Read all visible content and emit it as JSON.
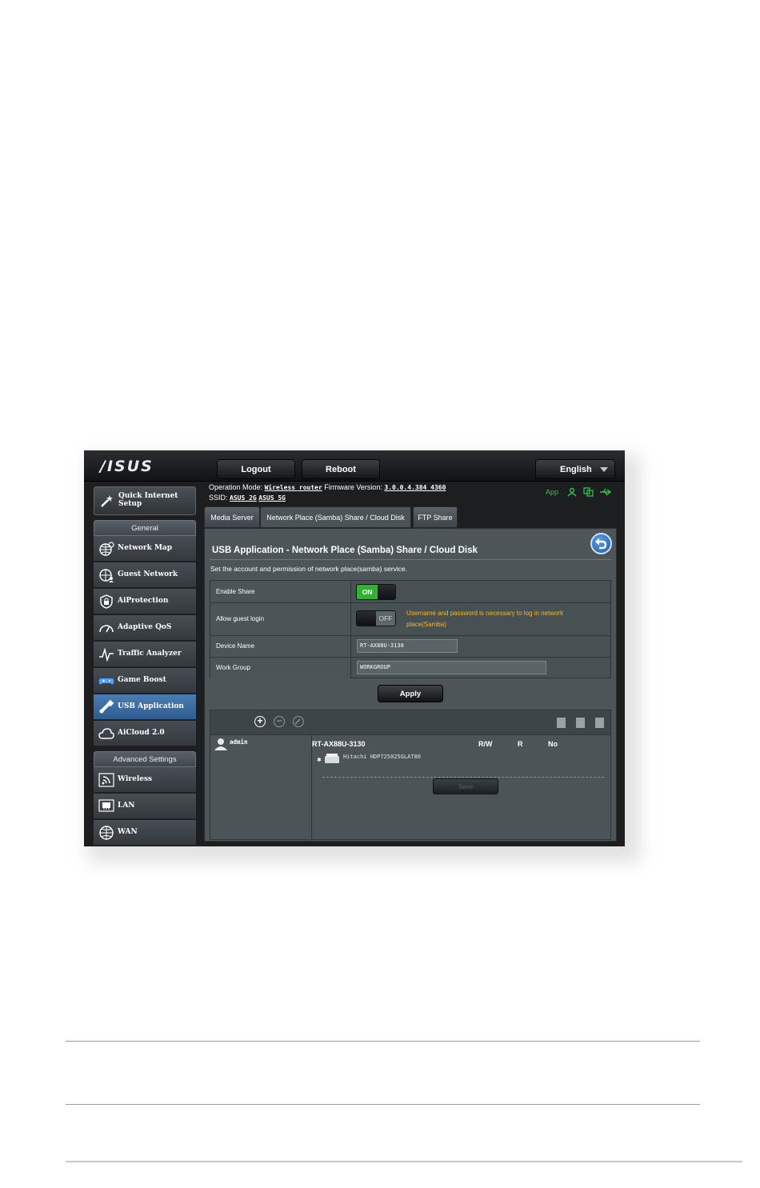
{
  "header": {
    "logo": "/ISUS",
    "logout_label": "Logout",
    "reboot_label": "Reboot",
    "language": "English"
  },
  "status": {
    "operation_mode_label": "Operation Mode:",
    "operation_mode_value": "Wireless router",
    "firmware_label": "Firmware Version:",
    "firmware_value": "3.0.0.4.384_4360",
    "ssid_label": "SSID:",
    "ssid_2g": "ASUS_2G",
    "ssid_5g": "ASUS_5G",
    "app_label": "App"
  },
  "sidebar": {
    "quick_setup": "Quick Internet Setup",
    "general_header": "General",
    "general_items": [
      {
        "label": "Network Map",
        "icon": "globe-icon"
      },
      {
        "label": "Guest Network",
        "icon": "guest-globe-icon"
      },
      {
        "label": "AiProtection",
        "icon": "shield-lock-icon"
      },
      {
        "label": "Adaptive QoS",
        "icon": "gauge-icon"
      },
      {
        "label": "Traffic Analyzer",
        "icon": "traffic-icon"
      },
      {
        "label": "Game Boost",
        "icon": "gamepad-icon"
      },
      {
        "label": "USB Application",
        "icon": "usb-icon"
      },
      {
        "label": "AiCloud 2.0",
        "icon": "cloud-icon"
      }
    ],
    "advanced_header": "Advanced Settings",
    "advanced_items": [
      {
        "label": "Wireless",
        "icon": "wifi-icon"
      },
      {
        "label": "LAN",
        "icon": "lan-icon"
      },
      {
        "label": "WAN",
        "icon": "wan-globe-icon"
      }
    ]
  },
  "tabs": [
    "Media Server",
    "Network Place (Samba) Share / Cloud Disk",
    "FTP Share"
  ],
  "main": {
    "title": "USB Application - Network Place (Samba) Share / Cloud Disk",
    "description": "Set the account and permission of network place(samba) service.",
    "enable_share_label": "Enable Share",
    "enable_share_state": "ON",
    "guest_login_label": "Allow guest login",
    "guest_login_state": "OFF",
    "guest_warning": "Username and password is necessary to log in network place(Samba)",
    "device_name_label": "Device Name",
    "device_name_value": "RT-AX88U-3130",
    "work_group_label": "Work Group",
    "work_group_value": "WORKGROUP",
    "apply_label": "Apply",
    "user": "admin",
    "device_header": "RT-AX88U-3130",
    "col_rw": "R/W",
    "col_r": "R",
    "col_no": "No",
    "disk_name": "Hitachi HDP725025GLAT80",
    "save_label": "Save"
  }
}
